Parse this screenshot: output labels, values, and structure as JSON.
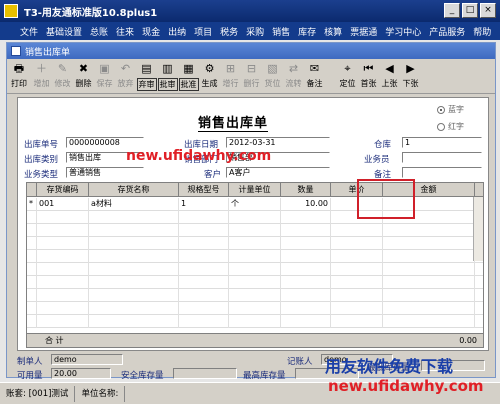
{
  "window": {
    "title": "T3-用友通标准版10.8plus1"
  },
  "menubar": [
    "文件",
    "基础设置",
    "总账",
    "往来",
    "现金",
    "出纳",
    "项目",
    "税务",
    "采购",
    "销售",
    "库存",
    "核算",
    "票据通",
    "学习中心",
    "产品服务",
    "帮助"
  ],
  "document": {
    "tab_title": "销售出库单",
    "form_title": "销售出库单",
    "radio": {
      "blue": "蓝字",
      "red": "红字"
    }
  },
  "toolbar": [
    {
      "label": "打印",
      "icon": "print-icon",
      "glyph": "🖶"
    },
    {
      "label": "增加",
      "icon": "add-icon",
      "glyph": "＋",
      "disabled": true
    },
    {
      "label": "修改",
      "icon": "edit-icon",
      "glyph": "✎",
      "disabled": true
    },
    {
      "label": "删除",
      "icon": "delete-icon",
      "glyph": "✖"
    },
    {
      "label": "保存",
      "icon": "save-icon",
      "glyph": "▣",
      "disabled": true
    },
    {
      "label": "放弃",
      "icon": "discard-icon",
      "glyph": "↶",
      "disabled": true
    },
    {
      "label": "弃审",
      "icon": "unapprove-icon",
      "glyph": "▤",
      "boxed": true
    },
    {
      "label": "批审",
      "icon": "batch-approve-icon",
      "glyph": "▥",
      "boxed": true
    },
    {
      "label": "批准",
      "icon": "approve-icon",
      "glyph": "▦",
      "boxed": true
    },
    {
      "label": "生成",
      "icon": "generate-icon",
      "glyph": "⚙"
    },
    {
      "label": "增行",
      "icon": "add-row-icon",
      "glyph": "⊞",
      "disabled": true
    },
    {
      "label": "删行",
      "icon": "delete-row-icon",
      "glyph": "⊟",
      "disabled": true
    },
    {
      "label": "货位",
      "icon": "location-icon",
      "glyph": "▧",
      "disabled": true
    },
    {
      "label": "流转",
      "icon": "flow-icon",
      "glyph": "⇄",
      "disabled": true
    },
    {
      "label": "备注",
      "icon": "note-icon",
      "glyph": "✉"
    },
    {
      "label": "定位",
      "icon": "locate-icon",
      "glyph": "⌖"
    },
    {
      "label": "首张",
      "icon": "first-icon",
      "glyph": "⏮"
    },
    {
      "label": "上张",
      "icon": "prev-icon",
      "glyph": "◀"
    },
    {
      "label": "下张",
      "icon": "next-icon",
      "glyph": "▶"
    }
  ],
  "header": {
    "doc_no_label": "出库单号",
    "doc_no": "0000000008",
    "date_label": "出库日期",
    "date": "2012-03-31",
    "warehouse_label": "仓库",
    "warehouse": "1",
    "type_label": "出库类别",
    "type": "销售出库",
    "dept_label": "销售部门",
    "dept": "销售部",
    "salesperson_label": "业务员",
    "salesperson": "",
    "biz_type_label": "业务类型",
    "biz_type": "普通销售",
    "customer_label": "客户",
    "customer": "A客户",
    "remark_label": "备注",
    "remark": ""
  },
  "grid": {
    "columns": [
      "",
      "存货编码",
      "存货名称",
      "规格型号",
      "计量单位",
      "数量",
      "单价",
      "金额"
    ],
    "rows": [
      {
        "marker": "*",
        "code": "001",
        "name": "a材料",
        "spec": "1",
        "unit": "个",
        "qty": "10.00",
        "price": "",
        "amount": ""
      }
    ],
    "total_label": "合 计",
    "total_amount": "0.00"
  },
  "footer": {
    "maker_label": "制单人",
    "maker": "demo",
    "recorder_label": "记账人",
    "recorder": "demo",
    "available_label": "可用量",
    "available": "20.00",
    "safe_stock_label": "安全库存量",
    "max_stock_label": "最高库存量",
    "min_stock_label": "最低库存量"
  },
  "status": {
    "account": "账套: [001]测试",
    "unit": "单位名称:"
  },
  "watermarks": {
    "url1": "new.ufidawhy.com",
    "cn": "用友软件免费下载",
    "url2": "new.ufidawhy.com"
  }
}
